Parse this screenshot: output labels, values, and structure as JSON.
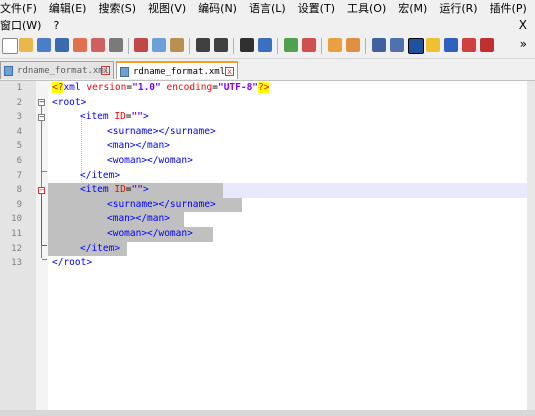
{
  "menu": {
    "row1": [
      "文件(F)",
      "编辑(E)",
      "搜索(S)",
      "视图(V)",
      "编码(N)",
      "语言(L)",
      "设置(T)",
      "工具(O)",
      "宏(M)",
      "运行(R)",
      "插件(P)"
    ],
    "row2": [
      "窗口(W)",
      "?"
    ],
    "close": "X",
    "overflow": "»"
  },
  "tabs": [
    {
      "label": "rdname_format.xml",
      "active": false
    },
    {
      "label": "rdname_format.xml",
      "active": true
    }
  ],
  "tab_close": "x",
  "editor": {
    "line_numbers": [
      "1",
      "2",
      "3",
      "4",
      "5",
      "6",
      "7",
      "8",
      "9",
      "10",
      "11",
      "12",
      "13"
    ],
    "lines": {
      "l1": {
        "pi_open": "<?",
        "decl": "xml",
        "a1": "version",
        "eq1": "=",
        "v1": "\"1.0\"",
        "a2": "encoding",
        "eq2": "=",
        "v2": "\"UTF-8\"",
        "pi_close": "?>"
      },
      "l2": {
        "t": "<root>"
      },
      "l3": {
        "t": "<item",
        "a": "ID",
        "eq": "=",
        "v": "\"\"",
        "close": ">"
      },
      "l4": {
        "t": "<surname></surname>"
      },
      "l5": {
        "t": "<man></man>"
      },
      "l6": {
        "t": "<woman></woman>"
      },
      "l7": {
        "t": "</item>"
      },
      "l8": {
        "t": "<item",
        "a": "ID",
        "eq": "=",
        "v": "\"\"",
        "close": ">"
      },
      "l9": {
        "t": "<surname></surname>"
      },
      "l10": {
        "t": "<man></man>"
      },
      "l11": {
        "t": "<woman></woman>"
      },
      "l12": {
        "t": "</item>"
      },
      "l13": {
        "t": "</root>"
      }
    },
    "fold_minus": "−"
  },
  "colors": {
    "tag": "#0000ff",
    "attribute": "#ff0000",
    "value": "#8000ff",
    "selection": "#c0c0c0",
    "current_line": "#e8e8ff",
    "active_tab_accent": "#f6a023"
  }
}
